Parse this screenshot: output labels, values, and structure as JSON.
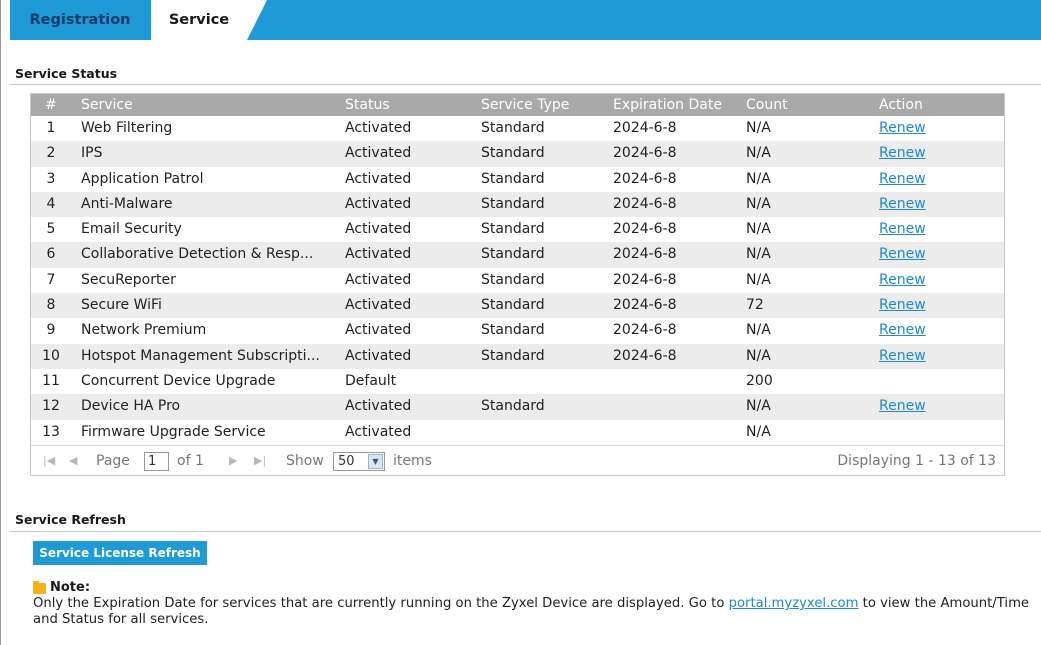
{
  "tabs": [
    {
      "label": "Registration",
      "active": false
    },
    {
      "label": "Service",
      "active": true
    }
  ],
  "status_section": {
    "title": "Service Status"
  },
  "table": {
    "headers": {
      "num": "#",
      "service": "Service",
      "status": "Status",
      "type": "Service Type",
      "expiration": "Expiration Date",
      "count": "Count",
      "action": "Action"
    },
    "rows": [
      {
        "num": "1",
        "service": "Web Filtering",
        "status": "Activated",
        "type": "Standard",
        "expiration": "2024-6-8",
        "count": "N/A",
        "action": "Renew"
      },
      {
        "num": "2",
        "service": "IPS",
        "status": "Activated",
        "type": "Standard",
        "expiration": "2024-6-8",
        "count": "N/A",
        "action": "Renew"
      },
      {
        "num": "3",
        "service": "Application Patrol",
        "status": "Activated",
        "type": "Standard",
        "expiration": "2024-6-8",
        "count": "N/A",
        "action": "Renew"
      },
      {
        "num": "4",
        "service": "Anti-Malware",
        "status": "Activated",
        "type": "Standard",
        "expiration": "2024-6-8",
        "count": "N/A",
        "action": "Renew"
      },
      {
        "num": "5",
        "service": "Email Security",
        "status": "Activated",
        "type": "Standard",
        "expiration": "2024-6-8",
        "count": "N/A",
        "action": "Renew"
      },
      {
        "num": "6",
        "service": "Collaborative Detection & Resp...",
        "status": "Activated",
        "type": "Standard",
        "expiration": "2024-6-8",
        "count": "N/A",
        "action": "Renew"
      },
      {
        "num": "7",
        "service": "SecuReporter",
        "status": "Activated",
        "type": "Standard",
        "expiration": "2024-6-8",
        "count": "N/A",
        "action": "Renew"
      },
      {
        "num": "8",
        "service": "Secure WiFi",
        "status": "Activated",
        "type": "Standard",
        "expiration": "2024-6-8",
        "count": "72",
        "action": "Renew"
      },
      {
        "num": "9",
        "service": "Network Premium",
        "status": "Activated",
        "type": "Standard",
        "expiration": "2024-6-8",
        "count": "N/A",
        "action": "Renew"
      },
      {
        "num": "10",
        "service": "Hotspot Management Subscripti...",
        "status": "Activated",
        "type": "Standard",
        "expiration": "2024-6-8",
        "count": "N/A",
        "action": "Renew"
      },
      {
        "num": "11",
        "service": "Concurrent Device Upgrade",
        "status": "Default",
        "type": "",
        "expiration": "",
        "count": "200",
        "action": ""
      },
      {
        "num": "12",
        "service": "Device HA Pro",
        "status": "Activated",
        "type": "Standard",
        "expiration": "",
        "count": "N/A",
        "action": "Renew"
      },
      {
        "num": "13",
        "service": "Firmware Upgrade Service",
        "status": "Activated",
        "type": "",
        "expiration": "",
        "count": "N/A",
        "action": ""
      }
    ]
  },
  "pager": {
    "page_label": "Page",
    "page_value": "1",
    "of_label": "of 1",
    "show_label": "Show",
    "show_value": "50",
    "items_label": "items",
    "displaying": "Displaying 1 - 13 of 13"
  },
  "refresh_section": {
    "title": "Service Refresh",
    "button_label": "Service License Refresh"
  },
  "note": {
    "title": "Note:",
    "text_before": "Only the Expiration Date for services that are currently running on the Zyxel Device are displayed. Go to ",
    "link": "portal.myzyxel.com",
    "text_after": " to view the Amount/Time and Status for all services."
  },
  "colors": {
    "accent": "#1e9ad6",
    "header_gray": "#a9a9a9",
    "link": "#1e8ad0",
    "note_icon": "#f3b21a"
  }
}
